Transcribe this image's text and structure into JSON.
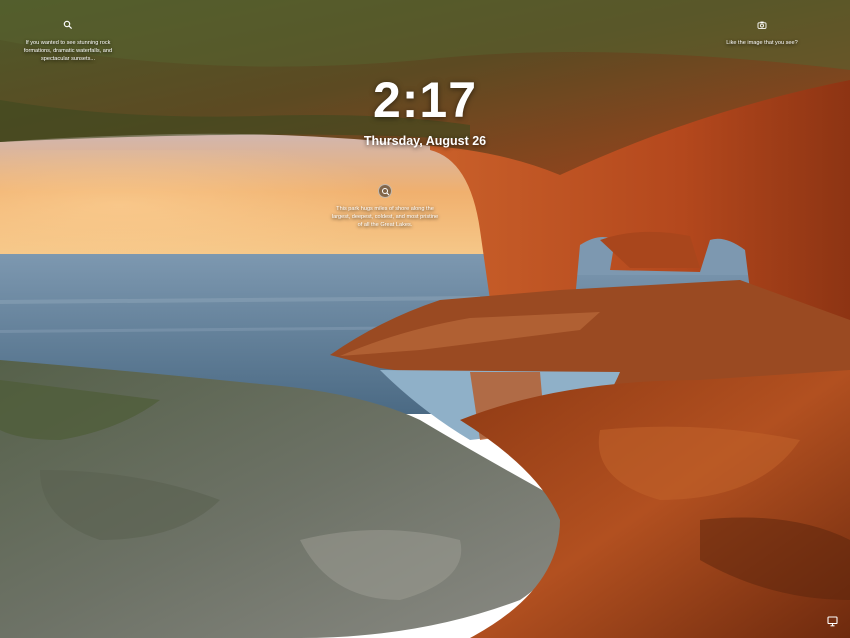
{
  "lockscreen": {
    "time": "2:17",
    "date": "Thursday, August 26"
  },
  "hotspots": {
    "left_text": "If you wanted to see stunning rock formations, dramatic waterfalls, and spectacular sunsets...",
    "center_text": "This park hugs miles of shore along the largest, deepest, coldest, and most pristine of all the Great Lakes.",
    "right_text": "Like the image that you see?"
  },
  "icons": {
    "left_hotspot": "search-icon",
    "center_hotspot": "search-icon",
    "right_hotspot": "camera-icon",
    "corner": "display-icon"
  },
  "colors": {
    "sky_top": "#8fb3d2",
    "sunset": "#f2b36a",
    "sea": "#5f7f98",
    "rock_orange": "#b8461c",
    "rock_green": "#4a5a2c"
  }
}
